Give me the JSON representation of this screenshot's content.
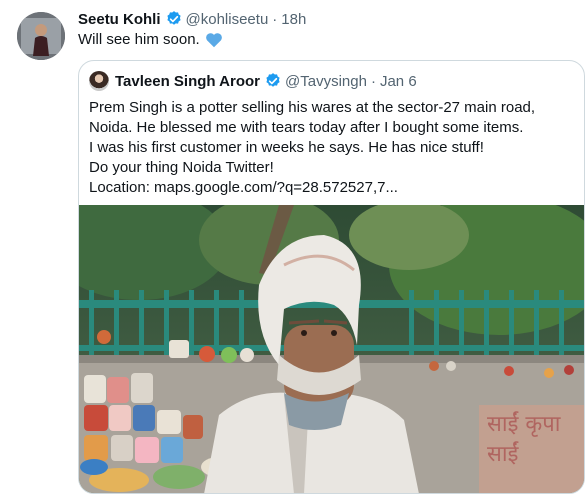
{
  "tweet": {
    "name": "Seetu Kohli",
    "handle": "@kohliseetu",
    "time": "18h",
    "text": "Will see him soon.",
    "emoji_icon": "blue-heart-icon"
  },
  "quote": {
    "name": "Tavleen Singh Aroor",
    "handle": "@Tavysingh",
    "date": "Jan 6",
    "lines": [
      "Prem Singh is a potter selling his wares at the sector-27 main road,",
      "Noida. He blessed me with tears today after I bought some items.",
      "I was his first customer in weeks he says. He has nice stuff!",
      "Do your thing Noida Twitter!",
      "Location: maps.google.com/?q=28.572527,7..."
    ],
    "media": {
      "description_icon": "photo-man-with-pots",
      "wall_text": "साईं कृपा\nसाईं"
    }
  },
  "colors": {
    "verified": "#1d9bf0",
    "heart": "#5aa9e6",
    "muted": "#536471",
    "border": "#cfd9de"
  }
}
